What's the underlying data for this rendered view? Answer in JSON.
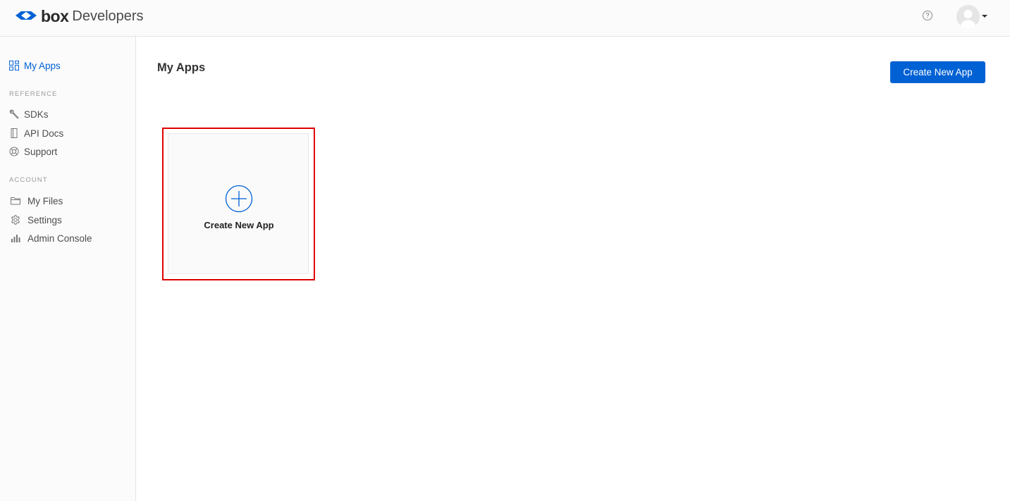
{
  "brand": {
    "name_bold": "box",
    "name_light": "Developers"
  },
  "header": {
    "help_icon": "question-circle-icon",
    "avatar_icon": "user-avatar-icon"
  },
  "sidebar": {
    "my_apps": "My Apps",
    "reference_heading": "REFERENCE",
    "reference_items": [
      "SDKs",
      "API Docs",
      "Support"
    ],
    "account_heading": "ACCOUNT",
    "account_items": [
      "My Files",
      "Settings",
      "Admin Console"
    ]
  },
  "main": {
    "title": "My Apps",
    "create_button": "Create New App",
    "card_label": "Create New App"
  },
  "colors": {
    "accent": "#0061d5",
    "highlight": "#e00000"
  }
}
